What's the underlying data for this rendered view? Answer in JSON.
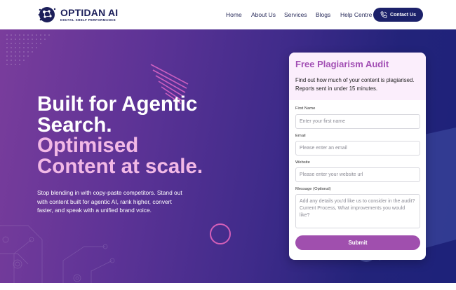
{
  "brand": {
    "name": "OPTIDAN AI",
    "tagline": "DIGITAL SHELF PERFORMANCE"
  },
  "nav": {
    "items": [
      {
        "label": "Home"
      },
      {
        "label": "About Us"
      },
      {
        "label": "Services"
      },
      {
        "label": "Blogs"
      },
      {
        "label": "Help Centre"
      }
    ],
    "contact_label": "Contact Us"
  },
  "hero": {
    "line1": "Built for Agentic",
    "line2": "Search.",
    "line3": "Optimised",
    "line4": "Content at scale.",
    "subtext": "Stop blending in with copy-paste competitors. Stand out with content built for agentic AI, rank higher, convert faster, and speak with a unified brand voice."
  },
  "form": {
    "title": "Free Plagiarism Audit",
    "description": "Find out how much of your content is plagiarised. Reports sent in under 15 minutes.",
    "first_name": {
      "label": "First Name",
      "placeholder": "Enter your first name"
    },
    "email": {
      "label": "Email",
      "placeholder": "Please enter an email"
    },
    "website": {
      "label": "Website",
      "placeholder": "Please enter your website url"
    },
    "message": {
      "label": "Message (Optional)",
      "placeholder": "Add any details you'd like us to consider in the audit? Current Process, What improvements you would like?"
    },
    "submit_label": "Submit"
  },
  "colors": {
    "accent_pink": "#f2b9e6",
    "brand_navy": "#1c216a",
    "button_purple": "#a04fae",
    "title_purple": "#a24fb4"
  },
  "icons": {
    "contact": "phone-icon",
    "logo": "brain-circuit-icon"
  }
}
